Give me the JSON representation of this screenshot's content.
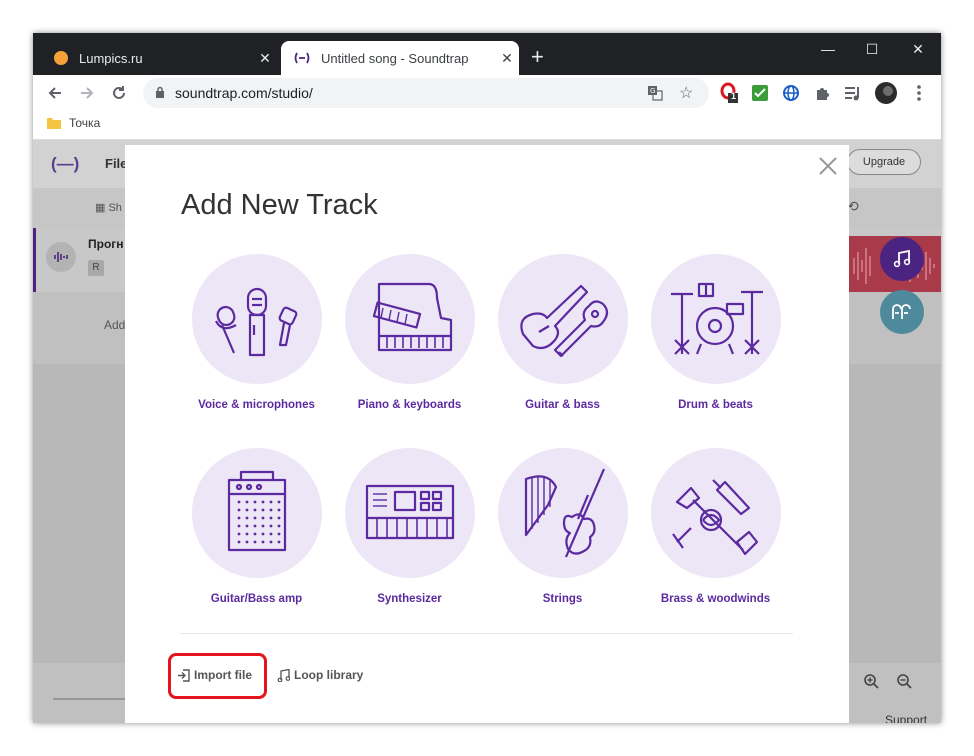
{
  "browser": {
    "tabs": [
      {
        "title": "Lumpics.ru",
        "favicon_color": "#f4a237",
        "active": false
      },
      {
        "title": "Untitled song - Soundtrap",
        "active": true
      }
    ],
    "url": "soundtrap.com/studio/",
    "bookmarks": [
      {
        "label": "Точка"
      }
    ],
    "extension_badge": "1"
  },
  "app": {
    "logo": "(—)",
    "file_menu": "File",
    "upgrade_label": "Upgrade",
    "subbar_partial": "Sh",
    "track_name_partial": "Прогн",
    "track_r": "R",
    "add_partial": "Add",
    "support": "Support",
    "colors": {
      "brand": "#4b2380",
      "record_region": "#a83a49",
      "fab_teal": "#4e8a9c"
    }
  },
  "modal": {
    "title": "Add New Track",
    "instruments": [
      {
        "label": "Voice & microphones",
        "icon": "microphones-icon"
      },
      {
        "label": "Piano & keyboards",
        "icon": "piano-icon"
      },
      {
        "label": "Guitar & bass",
        "icon": "guitars-icon"
      },
      {
        "label": "Drum & beats",
        "icon": "drums-icon"
      },
      {
        "label": "Guitar/Bass amp",
        "icon": "amp-icon"
      },
      {
        "label": "Synthesizer",
        "icon": "synth-icon"
      },
      {
        "label": "Strings",
        "icon": "strings-icon"
      },
      {
        "label": "Brass & woodwinds",
        "icon": "brass-icon"
      }
    ],
    "import_label": "Import file",
    "loop_label": "Loop library",
    "accent": "#5b2aa0",
    "highlight": "#e3141b"
  }
}
